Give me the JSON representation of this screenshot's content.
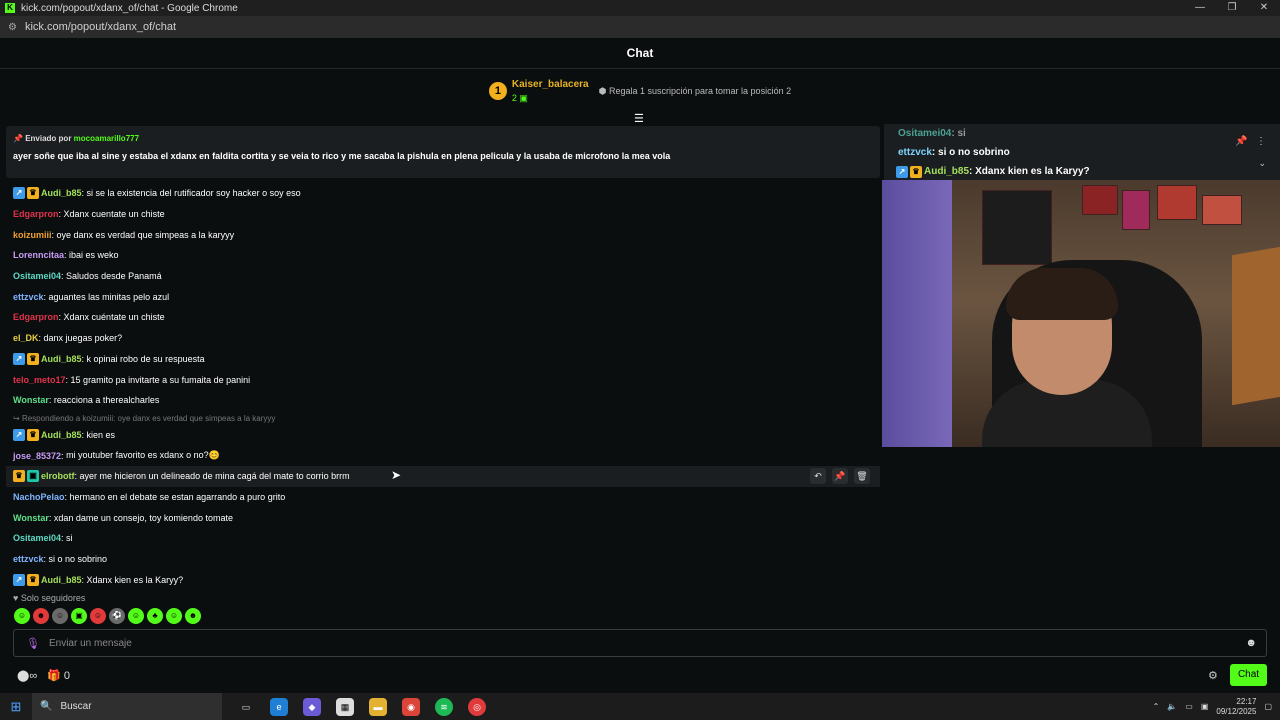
{
  "window": {
    "title": "kick.com/popout/xdanx_of/chat - Google Chrome",
    "url": "kick.com/popout/xdanx_of/chat",
    "min": "—",
    "restore": "❐",
    "close": "✕"
  },
  "header": {
    "title": "Chat"
  },
  "leaderboard": {
    "rank": "1",
    "name": "Kaiser_balacera",
    "count": "2",
    "gift_text": "Regala 1 suscripción para tomar la posición 2"
  },
  "pinned": {
    "by_label": "Enviado por",
    "by_user": "mocoamarillo777",
    "text": "ayer soñe que iba al sine y estaba el xdanx en faldita cortita y se veia to rico y me sacaba la pishula en plena pelicula y la usaba de microfono la mea vola"
  },
  "overlay": {
    "lines": [
      {
        "user": "Ositamei04",
        "text": ": si"
      },
      {
        "user": "ettzvck",
        "text": ": si o no sobrino"
      },
      {
        "user": "Audi_b85",
        "text": ": Xdanx kien es la Karyy?"
      }
    ]
  },
  "messages": [
    {
      "user": "Audi_b85",
      "color": "#a4e05a",
      "badges": [
        "blue",
        "gold"
      ],
      "text": "si se la existencia del rutificador soy hacker o soy eso"
    },
    {
      "user": "Edgarpron",
      "color": "#e0334a",
      "badges": [],
      "text": "Xdanx cuentate un chiste"
    },
    {
      "user": "koizumiii",
      "color": "#f0a032",
      "badges": [],
      "text": "oye danx es verdad que simpeas a la karyyy"
    },
    {
      "user": "Lorenncitaa",
      "color": "#c89bf5",
      "badges": [],
      "text": "ibai es weko"
    },
    {
      "user": "Ositamei04",
      "color": "#5fd9c4",
      "badges": [],
      "text": "Saludos desde Panamá"
    },
    {
      "user": "ettzvck",
      "color": "#7fb4ff",
      "badges": [],
      "text": "aguantes las minitas pelo azul"
    },
    {
      "user": "Edgarpron",
      "color": "#e0334a",
      "badges": [],
      "text": "Xdanx cuéntate un chiste"
    },
    {
      "user": "el_DK",
      "color": "#e6d04a",
      "badges": [],
      "text": "danx juegas poker?"
    },
    {
      "user": "Audi_b85",
      "color": "#a4e05a",
      "badges": [
        "blue",
        "gold"
      ],
      "text": "k opinai robo de su respuesta"
    },
    {
      "user": "telo_meto17",
      "color": "#e0334a",
      "badges": [],
      "text": "15 gramito pa invitarte a su fumaita de panini"
    },
    {
      "user": "Wonstar",
      "color": "#5fe08a",
      "badges": [],
      "text": "reacciona a therealcharles"
    }
  ],
  "reply": {
    "text": "Respondiendo a koizumiii: oye danx es verdad que simpeas a la karyyy"
  },
  "messages2": [
    {
      "user": "Audi_b85",
      "color": "#a4e05a",
      "badges": [
        "blue",
        "gold"
      ],
      "text": "kien es"
    },
    {
      "user": "jose_85372",
      "color": "#c89bf5",
      "badges": [],
      "text": "mi youtuber favorito es xdanx o no?😊"
    },
    {
      "user": "elrobotf",
      "color": "#a4e05a",
      "badges": [
        "gold",
        "green"
      ],
      "text": "ayer me hicieron un delineado de mina cagá del mate to corrio brrm"
    },
    {
      "user": "NachoPelao",
      "color": "#7fb4ff",
      "badges": [],
      "text": "hermano en el debate se estan agarrando a puro grito"
    },
    {
      "user": "Wonstar",
      "color": "#5fe08a",
      "badges": [],
      "text": "xdan dame un consejo, toy komiendo tomate"
    },
    {
      "user": "Ositamei04",
      "color": "#5fd9c4",
      "badges": [],
      "text": "si"
    },
    {
      "user": "ettzvck",
      "color": "#7fb4ff",
      "badges": [],
      "text": "si o no sobrino"
    },
    {
      "user": "Audi_b85",
      "color": "#a4e05a",
      "badges": [
        "blue",
        "gold"
      ],
      "text": "Xdanx kien es la Karyy?"
    }
  ],
  "followers_only": "Solo seguidores",
  "input": {
    "placeholder": "Enviar un mensaje"
  },
  "bottom": {
    "points": "∞",
    "count": "0",
    "chat_button": "Chat"
  },
  "taskbar": {
    "search": "Buscar",
    "time": "22:17",
    "date": "09/12/2025"
  },
  "colors": {
    "accent": "#53fc18",
    "background": "#0b0e0f"
  }
}
